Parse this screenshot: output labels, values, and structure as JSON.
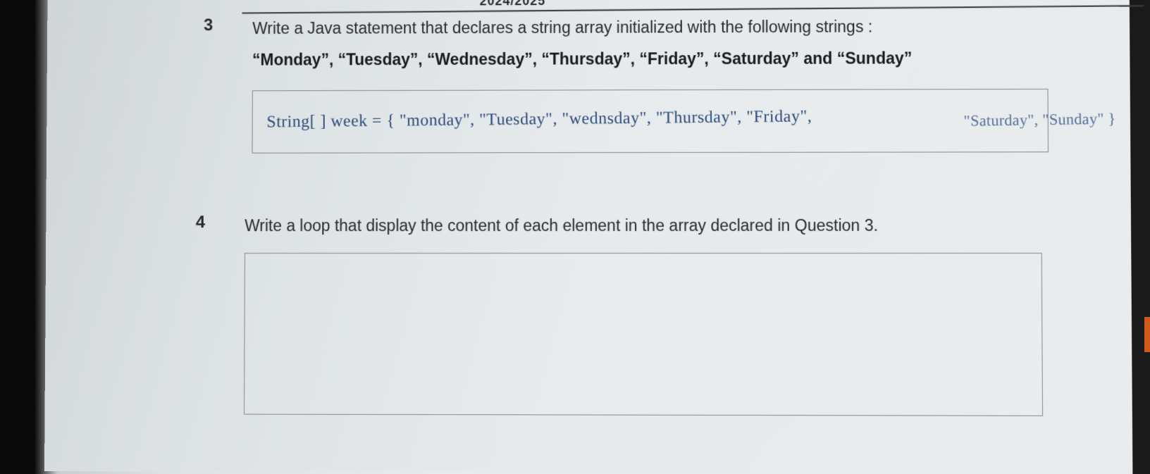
{
  "header": {
    "partial_text": "2024/2025"
  },
  "questions": {
    "q3": {
      "number": "3",
      "prompt_line1": "Write a Java statement that declares a string array initialized with the following strings :",
      "prompt_line2": "“Monday”, “Tuesday”, “Wednesday”, “Thursday”, “Friday”, “Saturday” and “Sunday”",
      "handwritten_answer_main": "String[ ] week = { \"monday\", \"Tuesday\", \"wednsday\", \"Thursday\", \"Friday\",",
      "handwritten_answer_overflow": "\"Saturday\", \"Sunday\" }"
    },
    "q4": {
      "number": "4",
      "prompt": "Write a loop that display the content of each element in the array declared in Question 3."
    }
  }
}
